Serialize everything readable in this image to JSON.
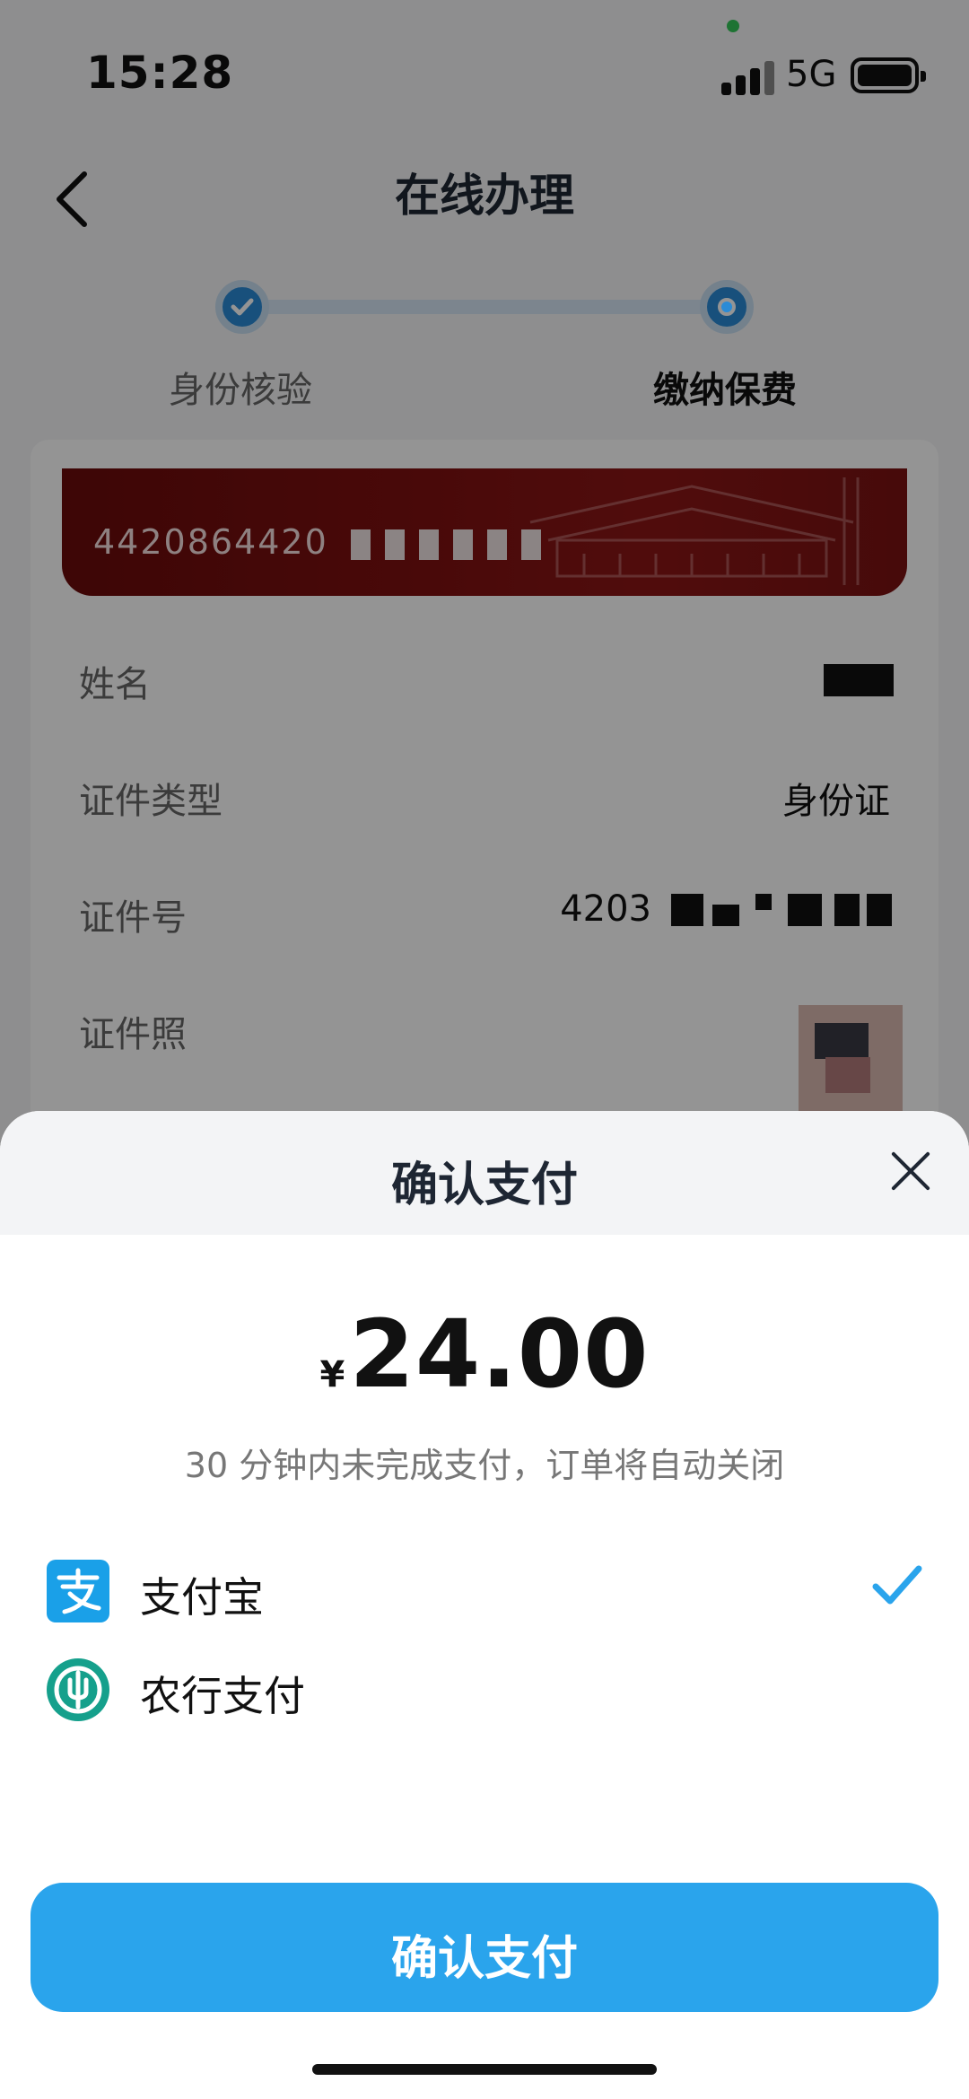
{
  "status": {
    "time": "15:28",
    "network": "5G"
  },
  "nav": {
    "title": "在线办理"
  },
  "steps": [
    {
      "label": "身份核验",
      "state": "done"
    },
    {
      "label": "缴纳保费",
      "state": "current"
    }
  ],
  "id_card": {
    "number_visible": "4420864420"
  },
  "fields": {
    "name_label": "姓名",
    "id_type_label": "证件类型",
    "id_type_value": "身份证",
    "id_number_label": "证件号",
    "id_number_visible": "4203",
    "photo_label": "证件照"
  },
  "sheet": {
    "title": "确认支付",
    "currency": "¥",
    "amount": "24.00",
    "hint": "30 分钟内未完成支付，订单将自动关闭",
    "methods": [
      {
        "label": "支付宝",
        "icon": "alipay-icon",
        "selected": true
      },
      {
        "label": "农行支付",
        "icon": "abc-bank-icon",
        "selected": false
      }
    ],
    "confirm_label": "确认支付"
  },
  "colors": {
    "accent": "#2aa4ec",
    "step": "#2a8bd6",
    "alipay": "#1aa0e8",
    "abc": "#15a08c"
  }
}
